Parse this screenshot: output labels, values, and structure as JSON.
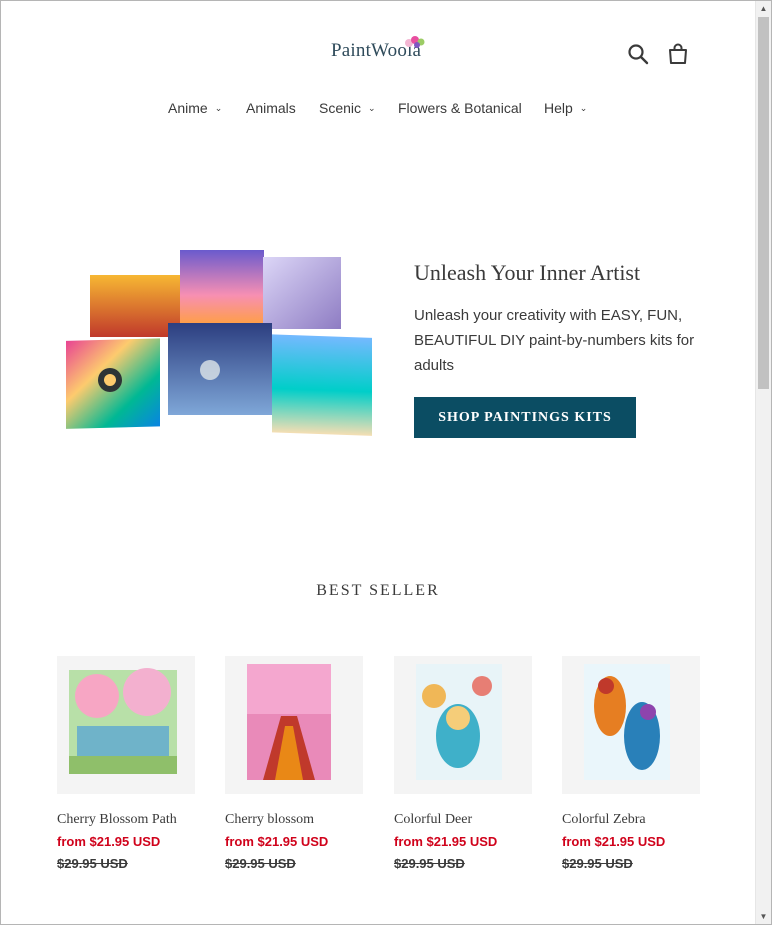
{
  "header": {
    "logo_text": "PaintWoola",
    "search_icon": "search-icon",
    "cart_icon": "cart-icon"
  },
  "nav": {
    "items": [
      {
        "label": "Anime",
        "has_dropdown": true
      },
      {
        "label": "Animals",
        "has_dropdown": false
      },
      {
        "label": "Scenic",
        "has_dropdown": true
      },
      {
        "label": "Flowers & Botanical",
        "has_dropdown": false
      },
      {
        "label": "Help",
        "has_dropdown": true
      }
    ]
  },
  "hero": {
    "title": "Unleash Your Inner Artist",
    "text": "Unleash your creativity with EASY, FUN, BEAUTIFUL DIY paint-by-numbers kits for adults",
    "button_label": "SHOP PAINTINGS KITS"
  },
  "best_seller": {
    "title": "BEST SELLER",
    "products": [
      {
        "name": "Cherry Blossom Path",
        "price": "from $21.95 USD",
        "compare_price": "$29.95 USD"
      },
      {
        "name": "Cherry blossom",
        "price": "from $21.95 USD",
        "compare_price": "$29.95 USD"
      },
      {
        "name": "Colorful Deer",
        "price": "from $21.95 USD",
        "compare_price": "$29.95 USD"
      },
      {
        "name": "Colorful Zebra",
        "price": "from $21.95 USD",
        "compare_price": "$29.95 USD"
      }
    ]
  },
  "colors": {
    "brand": "#2f4b5b",
    "button": "#0b4d63",
    "sale_price": "#d0021b"
  }
}
